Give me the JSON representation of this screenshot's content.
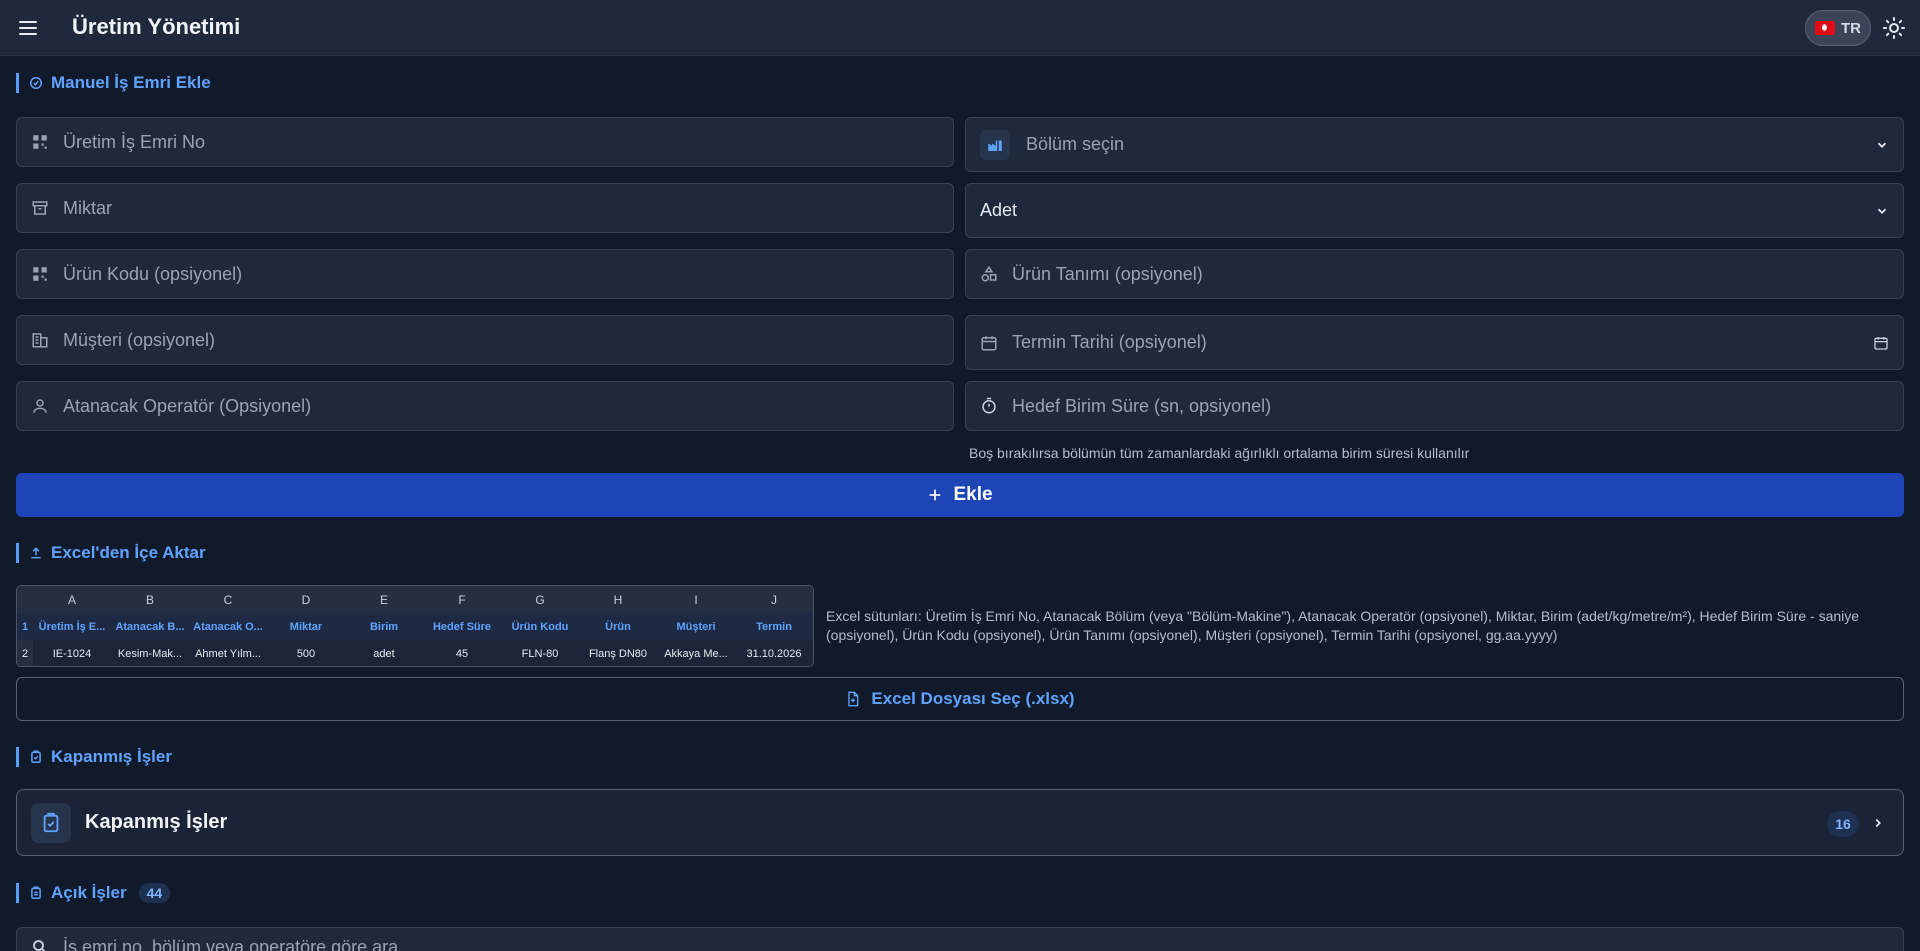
{
  "header": {
    "title": "Üretim Yönetimi",
    "language": "TR",
    "icons": [
      "menu-icon",
      "flag-tr-icon",
      "sun-icon"
    ]
  },
  "manual": {
    "title": "Manuel İş Emri Ekle",
    "work_order_placeholder": "Üretim İş Emri No",
    "department_placeholder": "Bölüm seçin",
    "quantity_placeholder": "Miktar",
    "unit_value": "Adet",
    "product_code_placeholder": "Ürün Kodu (opsiyonel)",
    "product_desc_placeholder": "Ürün Tanımı (opsiyonel)",
    "customer_placeholder": "Müşteri (opsiyonel)",
    "due_date_placeholder": "Termin Tarihi (opsiyonel)",
    "operator_placeholder": "Atanacak Operatör (Opsiyonel)",
    "target_time_placeholder": "Hedef Birim Süre (sn, opsiyonel)",
    "hint": "Boş bırakılırsa bölümün tüm zamanlardaki ağırlıklı ortalama birim süresi kullanılır",
    "add_label": "Ekle"
  },
  "excel": {
    "title": "Excel'den İçe Aktar",
    "columns": [
      "A",
      "B",
      "C",
      "D",
      "E",
      "F",
      "G",
      "H",
      "I",
      "J"
    ],
    "row_numbers": [
      "1",
      "2"
    ],
    "header_row": [
      "Üretim İş E...",
      "Atanacak B...",
      "Atanacak O...",
      "Miktar",
      "Birim",
      "Hedef Süre",
      "Ürün Kodu",
      "Ürün",
      "Müşteri",
      "Termin"
    ],
    "sample_row": [
      "IE-1024",
      "Kesim-Mak...",
      "Ahmet Yılm...",
      "500",
      "adet",
      "45",
      "FLN-80",
      "Flanş DN80",
      "Akkaya Me...",
      "31.10.2026"
    ],
    "description": "Excel sütunları: Üretim İş Emri No, Atanacak Bölüm (veya \"Bölüm-Makine\"), Atanacak Operatör (opsiyonel), Miktar, Birim (adet/kg/metre/m²), Hedef Birim Süre - saniye (opsiyonel), Ürün Kodu (opsiyonel), Ürün Tanımı (opsiyonel), Müşteri (opsiyonel), Termin Tarihi (opsiyonel, gg.aa.yyyy)",
    "button_label": "Excel Dosyası Seç (.xlsx)"
  },
  "closed": {
    "title": "Kapanmış İşler",
    "card_label": "Kapanmış İşler",
    "count": "16"
  },
  "open": {
    "title": "Açık İşler",
    "count": "44",
    "search_placeholder": "İş emri no, bölüm veya operatöre göre ara..."
  },
  "colors": {
    "accent": "#5ea3ff",
    "primary_button": "#1d45b5",
    "background": "#111a2b",
    "surface": "#1e293b"
  }
}
